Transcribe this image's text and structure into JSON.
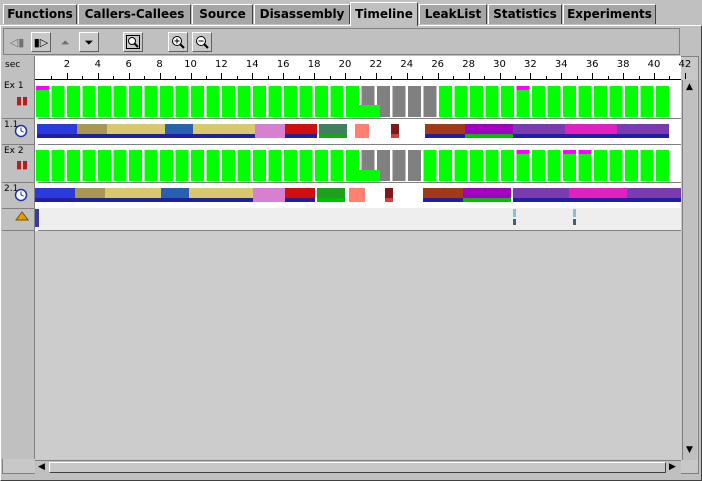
{
  "tabs": [
    {
      "label": "Functions",
      "active": false
    },
    {
      "label": "Callers-Callees",
      "active": false
    },
    {
      "label": "Source",
      "active": false
    },
    {
      "label": "Disassembly",
      "active": false
    },
    {
      "label": "Timeline",
      "active": true
    },
    {
      "label": "LeakList",
      "active": false
    },
    {
      "label": "Statistics",
      "active": false
    },
    {
      "label": "Experiments",
      "active": false
    }
  ],
  "toolbar": {
    "buttons": [
      {
        "name": "step-back-button",
        "icon": "step-back-icon"
      },
      {
        "name": "step-forward-button",
        "icon": "step-forward-icon"
      },
      {
        "name": "step-up-button",
        "icon": "step-up-icon"
      },
      {
        "name": "step-down-button",
        "icon": "step-down-icon"
      },
      {
        "name": "reset-zoom-button",
        "icon": "reset-zoom-icon"
      },
      {
        "name": "zoom-in-button",
        "icon": "zoom-in-icon"
      },
      {
        "name": "zoom-out-button",
        "icon": "zoom-out-icon"
      }
    ]
  },
  "ruler": {
    "unit_label": "sec",
    "ticks": [
      2,
      4,
      6,
      8,
      10,
      12,
      14,
      16,
      18,
      20,
      22,
      24,
      26,
      28,
      30,
      32,
      34,
      36,
      38,
      40,
      42
    ]
  },
  "rows": [
    {
      "label": "Ex 1",
      "kind": "experiment"
    },
    {
      "label": "1.1",
      "kind": "thread"
    },
    {
      "label": "Ex 2",
      "kind": "experiment"
    },
    {
      "label": "2.1",
      "kind": "thread"
    },
    {
      "label": "",
      "kind": "heap"
    }
  ],
  "colors": {
    "cpu_user": "#00ff00",
    "idle": "#808080",
    "lock": "#ff00ff",
    "selection": "#3a3aa0"
  }
}
